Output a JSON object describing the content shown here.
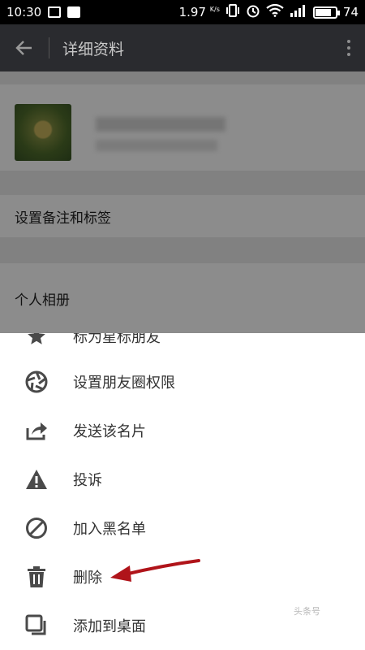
{
  "status_bar": {
    "time": "10:30",
    "speed": "1.97",
    "speed_unit": "K/s",
    "battery": "74"
  },
  "app_bar": {
    "title": "详细资料"
  },
  "profile": {
    "wechat_id_blurred": "微信号: wcl13980998811"
  },
  "rows": {
    "remark": "设置备注和标签",
    "album": "个人相册"
  },
  "menu": {
    "items": [
      {
        "label": "标为星标朋友",
        "icon": "star-icon"
      },
      {
        "label": "设置朋友圈权限",
        "icon": "aperture-icon"
      },
      {
        "label": "发送该名片",
        "icon": "share-icon"
      },
      {
        "label": "投诉",
        "icon": "warning-icon"
      },
      {
        "label": "加入黑名单",
        "icon": "block-icon"
      },
      {
        "label": "删除",
        "icon": "trash-icon"
      },
      {
        "label": "添加到桌面",
        "icon": "desktop-shortcut-icon"
      }
    ]
  },
  "watermark": "头条号",
  "colors": {
    "app_bar": "#2a2b2f",
    "annotation_arrow": "#b0141a",
    "icon": "#4a4a4a"
  }
}
